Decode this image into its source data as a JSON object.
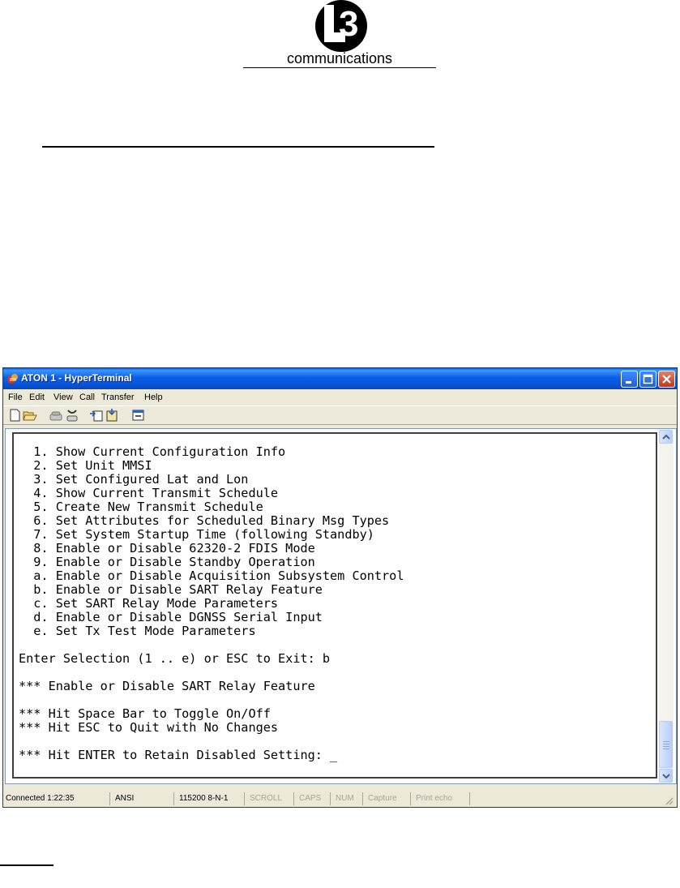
{
  "document": {
    "logo_mark": "L3",
    "logo_text": "communications"
  },
  "window": {
    "title": "ATON 1 - HyperTerminal",
    "menu": [
      "File",
      "Edit",
      "View",
      "Call",
      "Transfer",
      "Help"
    ],
    "toolbar_icons": [
      "new-icon",
      "open-icon",
      "call-icon",
      "disconnect-icon",
      "send-icon",
      "receive-icon",
      "properties-icon"
    ],
    "terminal_lines": [
      "  1. Show Current Configuration Info",
      "  2. Set Unit MMSI",
      "  3. Set Configured Lat and Lon",
      "  4. Show Current Transmit Schedule",
      "  5. Create New Transmit Schedule",
      "  6. Set Attributes for Scheduled Binary Msg Types",
      "  7. Set System Startup Time (following Standby)",
      "  8. Enable or Disable 62320-2 FDIS Mode",
      "  9. Enable or Disable Standby Operation",
      "  a. Enable or Disable Acquisition Subsystem Control",
      "  b. Enable or Disable SART Relay Feature",
      "  c. Set SART Relay Mode Parameters",
      "  d. Enable or Disable DGNSS Serial Input",
      "  e. Set Tx Test Mode Parameters",
      "",
      "Enter Selection (1 .. e) or ESC to Exit: b",
      "",
      "*** Enable or Disable SART Relay Feature",
      "",
      "*** Hit Space Bar to Toggle On/Off",
      "*** Hit ESC to Quit with No Changes",
      "",
      "*** Hit ENTER to Retain Disabled Setting: _"
    ],
    "status": {
      "connected": "Connected 1:22:35",
      "emulation": "ANSI",
      "port": "115200 8-N-1",
      "scroll": "SCROLL",
      "caps": "CAPS",
      "num": "NUM",
      "capture": "Capture",
      "print_echo": "Print echo"
    },
    "colors": {
      "titlebar": "#0a5fe8",
      "chrome": "#ece9d8",
      "terminal_bg": "#ffffff",
      "terminal_text": "#000000"
    }
  }
}
